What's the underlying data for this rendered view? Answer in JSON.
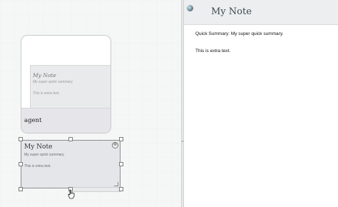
{
  "canvas": {
    "outer_card": {
      "inner_title": "My Note",
      "inner_summary": "My super quick summary.",
      "inner_extra": "This is extra text.",
      "agent_label": "agent"
    },
    "selected_note": {
      "title": "My Note",
      "summary": "My super quick summary.",
      "extra": "This is extra text.",
      "plus_glyph": "⊕"
    }
  },
  "preview": {
    "title": "My Note",
    "summary_line": "Quick Summary: My super quick summary.",
    "extra_line": "This is extra text."
  },
  "icons": {
    "cursor": "pointer-hand-icon",
    "orb": "sphere-icon"
  },
  "colors": {
    "canvas_bg": "#f5f7f6",
    "preview_header_bg": "#eceeef",
    "note_bg": "#e4e6ea"
  }
}
